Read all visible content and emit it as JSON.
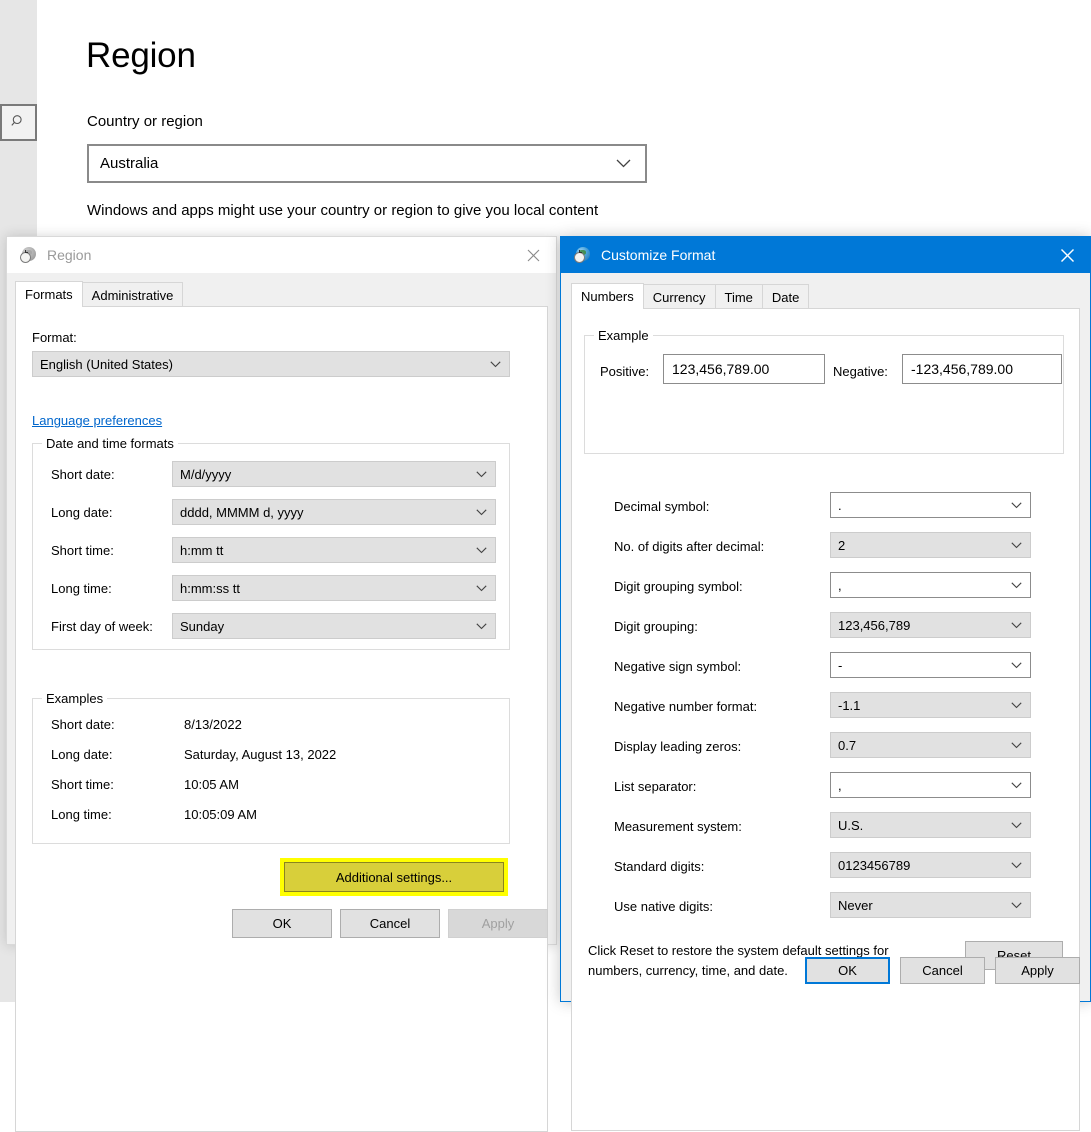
{
  "settings": {
    "nav": {
      "search_icon": "search-icon"
    },
    "page_title": "Region",
    "country_label": "Country or region",
    "country_value": "Australia",
    "country_description": "Windows and apps might use your country or region to give you local content"
  },
  "region_dialog": {
    "title": "Region",
    "icon": "region-globe-clock-icon",
    "close_label": "✕",
    "tabs": [
      {
        "label": "Formats",
        "active": true
      },
      {
        "label": "Administrative",
        "active": false
      }
    ],
    "format_label": "Format:",
    "format_value": "English (United States)",
    "language_preferences_link": "Language preferences",
    "datetime_group_label": "Date and time formats",
    "datetime_fields": [
      {
        "label": "Short date:",
        "value": "M/d/yyyy"
      },
      {
        "label": "Long date:",
        "value": "dddd, MMMM d, yyyy"
      },
      {
        "label": "Short time:",
        "value": "h:mm tt"
      },
      {
        "label": "Long time:",
        "value": "h:mm:ss tt"
      },
      {
        "label": "First day of week:",
        "value": "Sunday"
      }
    ],
    "examples_group_label": "Examples",
    "examples": [
      {
        "label": "Short date:",
        "value": "8/13/2022"
      },
      {
        "label": "Long date:",
        "value": "Saturday, August 13, 2022"
      },
      {
        "label": "Short time:",
        "value": "10:05 AM"
      },
      {
        "label": "Long time:",
        "value": "10:05:09 AM"
      }
    ],
    "additional_settings_label": "Additional settings...",
    "buttons": {
      "ok": "OK",
      "cancel": "Cancel",
      "apply": "Apply"
    },
    "highlight_color": "#ffff00"
  },
  "customize_dialog": {
    "title": "Customize Format",
    "icon": "region-globe-clock-icon",
    "close_label": "✕",
    "accent_color": "#0078d7",
    "tabs": [
      {
        "label": "Numbers",
        "active": true
      },
      {
        "label": "Currency",
        "active": false
      },
      {
        "label": "Time",
        "active": false
      },
      {
        "label": "Date",
        "active": false
      }
    ],
    "example_group_label": "Example",
    "example_positive_label": "Positive:",
    "example_positive_value": "123,456,789.00",
    "example_negative_label": "Negative:",
    "example_negative_value": "-123,456,789.00",
    "fields": [
      {
        "label": "Decimal symbol:",
        "value": ".",
        "style": "white"
      },
      {
        "label": "No. of digits after decimal:",
        "value": "2",
        "style": "grey"
      },
      {
        "label": "Digit grouping symbol:",
        "value": ",",
        "style": "white"
      },
      {
        "label": "Digit grouping:",
        "value": "123,456,789",
        "style": "grey"
      },
      {
        "label": "Negative sign symbol:",
        "value": "-",
        "style": "white"
      },
      {
        "label": "Negative number format:",
        "value": "-1.1",
        "style": "grey"
      },
      {
        "label": "Display leading zeros:",
        "value": "0.7",
        "style": "grey"
      },
      {
        "label": "List separator:",
        "value": ",",
        "style": "white"
      },
      {
        "label": "Measurement system:",
        "value": "U.S.",
        "style": "grey"
      },
      {
        "label": "Standard digits:",
        "value": "0123456789",
        "style": "grey"
      },
      {
        "label": "Use native digits:",
        "value": "Never",
        "style": "grey"
      }
    ],
    "reset_text_line1": "Click Reset to restore the system default settings for",
    "reset_text_line2": "numbers, currency, time, and date.",
    "reset_button": "Reset",
    "buttons": {
      "ok": "OK",
      "cancel": "Cancel",
      "apply": "Apply"
    }
  }
}
